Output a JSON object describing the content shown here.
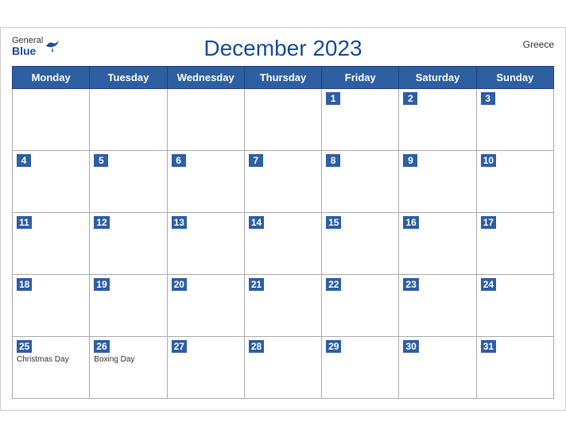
{
  "header": {
    "logo_general": "General",
    "logo_blue": "Blue",
    "title": "December 2023",
    "country": "Greece"
  },
  "weekdays": [
    "Monday",
    "Tuesday",
    "Wednesday",
    "Thursday",
    "Friday",
    "Saturday",
    "Sunday"
  ],
  "weeks": [
    [
      {
        "day": null,
        "events": []
      },
      {
        "day": null,
        "events": []
      },
      {
        "day": null,
        "events": []
      },
      {
        "day": null,
        "events": []
      },
      {
        "day": "1",
        "events": []
      },
      {
        "day": "2",
        "events": []
      },
      {
        "day": "3",
        "events": []
      }
    ],
    [
      {
        "day": "4",
        "events": []
      },
      {
        "day": "5",
        "events": []
      },
      {
        "day": "6",
        "events": []
      },
      {
        "day": "7",
        "events": []
      },
      {
        "day": "8",
        "events": []
      },
      {
        "day": "9",
        "events": []
      },
      {
        "day": "10",
        "events": []
      }
    ],
    [
      {
        "day": "11",
        "events": []
      },
      {
        "day": "12",
        "events": []
      },
      {
        "day": "13",
        "events": []
      },
      {
        "day": "14",
        "events": []
      },
      {
        "day": "15",
        "events": []
      },
      {
        "day": "16",
        "events": []
      },
      {
        "day": "17",
        "events": []
      }
    ],
    [
      {
        "day": "18",
        "events": []
      },
      {
        "day": "19",
        "events": []
      },
      {
        "day": "20",
        "events": []
      },
      {
        "day": "21",
        "events": []
      },
      {
        "day": "22",
        "events": []
      },
      {
        "day": "23",
        "events": []
      },
      {
        "day": "24",
        "events": []
      }
    ],
    [
      {
        "day": "25",
        "events": [
          "Christmas Day"
        ]
      },
      {
        "day": "26",
        "events": [
          "Boxing Day"
        ]
      },
      {
        "day": "27",
        "events": []
      },
      {
        "day": "28",
        "events": []
      },
      {
        "day": "29",
        "events": []
      },
      {
        "day": "30",
        "events": []
      },
      {
        "day": "31",
        "events": []
      }
    ]
  ]
}
